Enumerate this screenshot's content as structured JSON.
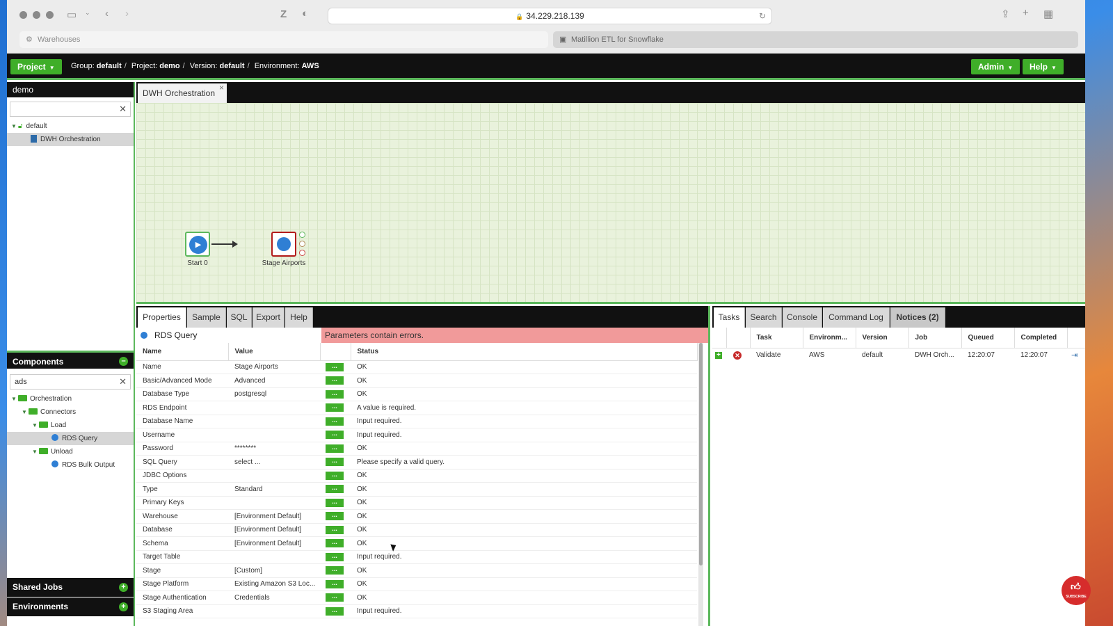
{
  "browser": {
    "url": "34.229.218.139",
    "tabs": [
      {
        "label": "Warehouses"
      },
      {
        "label": "Matillion ETL for Snowflake"
      }
    ],
    "reader_letter": "Z"
  },
  "header": {
    "project_button": "Project",
    "group_label": "Group:",
    "group_value": "default",
    "project_label": "Project:",
    "project_value": "demo",
    "version_label": "Version:",
    "version_value": "default",
    "environment_label": "Environment:",
    "environment_value": "AWS",
    "admin_button": "Admin",
    "help_button": "Help"
  },
  "project_tree": {
    "title": "demo",
    "search_value": "",
    "items": [
      {
        "label": "default"
      },
      {
        "label": "DWH Orchestration"
      }
    ]
  },
  "components": {
    "title": "Components",
    "search_value": "ads",
    "items": [
      {
        "label": "Orchestration"
      },
      {
        "label": "Connectors"
      },
      {
        "label": "Load"
      },
      {
        "label": "RDS Query"
      },
      {
        "label": "Unload"
      },
      {
        "label": "RDS Bulk Output"
      }
    ]
  },
  "shared_jobs_title": "Shared Jobs",
  "environments_title": "Environments",
  "job_tab": {
    "label": "DWH Orchestration",
    "close": "×"
  },
  "canvas": {
    "nodes": [
      {
        "label": "Start 0"
      },
      {
        "label": "Stage Airports"
      }
    ]
  },
  "properties": {
    "tabs": [
      "Properties",
      "Sample",
      "SQL",
      "Export",
      "Help"
    ],
    "component_name": "RDS Query",
    "error_message": "Parameters contain errors.",
    "columns": [
      "Name",
      "Value",
      "",
      "Status"
    ],
    "button_label": "...",
    "rows": [
      {
        "name": "Name",
        "value": "Stage Airports",
        "status": "OK",
        "ok": true
      },
      {
        "name": "Basic/Advanced Mode",
        "value": "Advanced",
        "status": "OK",
        "ok": true
      },
      {
        "name": "Database Type",
        "value": "postgresql",
        "status": "OK",
        "ok": true
      },
      {
        "name": "RDS Endpoint",
        "value": "",
        "status": "A value is required.",
        "ok": false
      },
      {
        "name": "Database Name",
        "value": "",
        "status": "Input required.",
        "ok": false
      },
      {
        "name": "Username",
        "value": "",
        "status": "Input required.",
        "ok": false
      },
      {
        "name": "Password",
        "value": "********",
        "status": "OK",
        "ok": true
      },
      {
        "name": "SQL Query",
        "value": "select ...",
        "status": "Please specify a valid query.",
        "ok": false
      },
      {
        "name": "JDBC Options",
        "value": "",
        "status": "OK",
        "ok": true
      },
      {
        "name": "Type",
        "value": "Standard",
        "status": "OK",
        "ok": true
      },
      {
        "name": "Primary Keys",
        "value": "",
        "status": "OK",
        "ok": true
      },
      {
        "name": "Warehouse",
        "value": "[Environment Default]",
        "status": "OK",
        "ok": true
      },
      {
        "name": "Database",
        "value": "[Environment Default]",
        "status": "OK",
        "ok": true
      },
      {
        "name": "Schema",
        "value": "[Environment Default]",
        "status": "OK",
        "ok": true
      },
      {
        "name": "Target Table",
        "value": "",
        "status": "Input required.",
        "ok": false
      },
      {
        "name": "Stage",
        "value": "[Custom]",
        "status": "OK",
        "ok": true
      },
      {
        "name": "Stage Platform",
        "value": "Existing Amazon S3 Loc...",
        "status": "OK",
        "ok": true
      },
      {
        "name": "Stage Authentication",
        "value": "Credentials",
        "status": "OK",
        "ok": true
      },
      {
        "name": "S3 Staging Area",
        "value": "",
        "status": "Input required.",
        "ok": false
      }
    ]
  },
  "tasks": {
    "tabs": [
      "Tasks",
      "Search",
      "Console",
      "Command Log",
      "Notices (2)"
    ],
    "columns": [
      "",
      "",
      "Task",
      "Environm...",
      "Version",
      "Job",
      "Queued",
      "Completed",
      ""
    ],
    "rows": [
      {
        "task": "Validate",
        "environment": "AWS",
        "version": "default",
        "job": "DWH Orch...",
        "queued": "12:20:07",
        "completed": "12:20:07"
      }
    ]
  },
  "subscribe_badge": "SUBSCRIBE",
  "colors": {
    "accent_green": "#3fae29",
    "error_red": "#b02020",
    "error_banner": "#f19a9a",
    "ok_green": "#3a9a2a"
  }
}
